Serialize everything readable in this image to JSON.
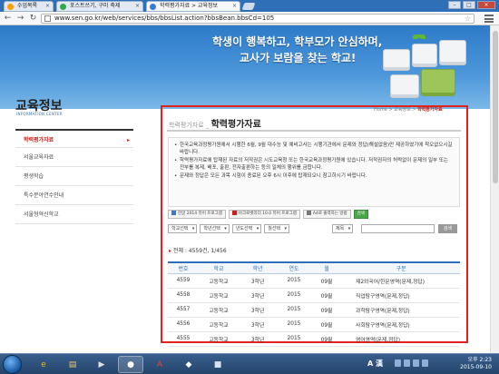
{
  "browser": {
    "tabs": [
      {
        "label": "수업목록"
      },
      {
        "label": "포스트쓰기, 구미 축제"
      },
      {
        "label": "학력평가자료 > 교육정보"
      }
    ],
    "url": "www.sen.go.kr/web/services/bbs/bbsList.action?bbsBean.bbsCd=105"
  },
  "banner": {
    "line1": "학생이 행복하고, 학부모가 안심하며,",
    "line2": "교사가 보람을 찾는 학교!"
  },
  "sidebar": {
    "title": "교육정보",
    "subtitle": "INFORMATION CENTER",
    "items": [
      {
        "label": "학력평가자료"
      },
      {
        "label": "서울교육자료"
      },
      {
        "label": "평생학습"
      },
      {
        "label": "특수분야연수안내"
      },
      {
        "label": "서울형혁신학교"
      }
    ]
  },
  "breadcrumb": {
    "home": "Home",
    "sep": ">",
    "section": "교육정보",
    "current": "학력평가자료"
  },
  "page": {
    "parent": "학력평가자료",
    "title": "학력평가자료",
    "notices": [
      "한국교육과정평가원에서 시행한 6월, 9월 대수능 및 예비고사는 시행기관에서 문제와 정답(해설없음)만 제공하였기에 착오없으시길 바랍니다.",
      "학력평가자료에 탑재된 자료의 저작권은 시도교육청 또는 한국교육과정평가원에 있습니다. 저작권자의 허락없이 문제의 일부 또는 전부를 복제, 배포, 출판, 전자출판하는 등의 일체의 행위를 금합니다.",
      "문제와 정답은 모든 과목 시험이 종료된 오후 6시 이후에 탑재되오니 참고하시기 바랍니다."
    ],
    "downloads": [
      {
        "label": "한글 2014 뷰어 프로그램"
      },
      {
        "label": "아크로벳리더 10.0 뷰어 프로그램"
      },
      {
        "label": "A4로 출력하는 방법"
      },
      {
        "label": "검색"
      }
    ],
    "filters": [
      "학교선택",
      "학년선택",
      "년도선택",
      "월선택"
    ],
    "search_field": "제목",
    "search_button": "검색",
    "total": "전체 : 4559건, 1/456",
    "table": {
      "headers": [
        "번호",
        "학교",
        "학년",
        "연도",
        "월",
        "구분"
      ],
      "rows": [
        [
          "4559",
          "고등학교",
          "3학년",
          "2015",
          "09월",
          "제2외국어/한문영역(문제,정답)"
        ],
        [
          "4558",
          "고등학교",
          "3학년",
          "2015",
          "09월",
          "직업탐구영역(문제,정답)"
        ],
        [
          "4557",
          "고등학교",
          "3학년",
          "2015",
          "09월",
          "과학탐구영역(문제,정답)"
        ],
        [
          "4556",
          "고등학교",
          "3학년",
          "2015",
          "09월",
          "사회탐구영역(문제,정답)"
        ],
        [
          "4555",
          "고등학교",
          "3학년",
          "2015",
          "09월",
          "영어영역(문제,정답)"
        ]
      ]
    }
  },
  "taskbar": {
    "ime": "A 漢",
    "time": "오후 2:23",
    "date": "2015-09-10"
  }
}
